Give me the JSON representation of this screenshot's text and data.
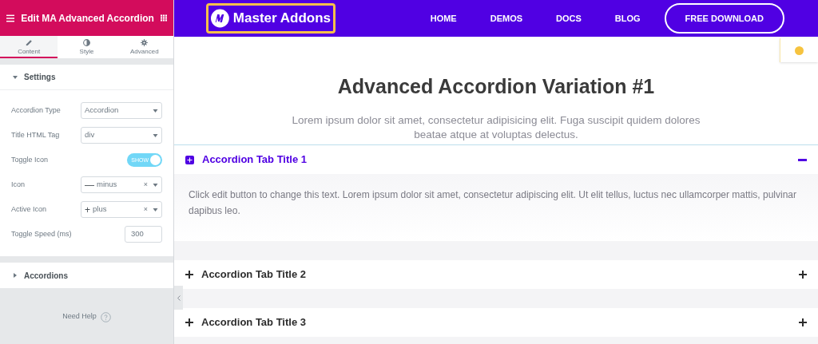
{
  "panel": {
    "title": "Edit MA Advanced Accordion",
    "tabs": [
      {
        "label": "Content",
        "selected": true
      },
      {
        "label": "Style",
        "selected": false
      },
      {
        "label": "Advanced",
        "selected": false
      }
    ],
    "sections": [
      {
        "title": "Settings",
        "expanded": true,
        "fields": [
          {
            "kind": "select",
            "label": "Accordion Type",
            "value": "Accordion"
          },
          {
            "kind": "select",
            "label": "Title HTML Tag",
            "value": "div"
          },
          {
            "kind": "toggle",
            "label": "Toggle Icon",
            "on": true,
            "text": "SHOW"
          },
          {
            "kind": "icon",
            "label": "Icon",
            "glyph": "—",
            "value": "minus",
            "clear": "×"
          },
          {
            "kind": "icon",
            "label": "Active Icon",
            "glyph": "+",
            "value": "plus",
            "clear": "×"
          },
          {
            "kind": "number",
            "label": "Toggle Speed (ms)",
            "value": "300"
          }
        ]
      },
      {
        "title": "Accordions",
        "expanded": false
      }
    ],
    "help": "Need Help"
  },
  "site": {
    "logo": "Master Addons",
    "nav": [
      "HOME",
      "DEMOS",
      "DOCS",
      "BLOG"
    ],
    "cta": "FREE DOWNLOAD",
    "heading": "Advanced Accordion Variation #1",
    "intro": "Lorem ipsum dolor sit amet, consectetur adipisicing elit. Fuga suscipit quidem dolores beatae atque at voluptas delectus.",
    "accordion": [
      {
        "title": "Accordion Tab Title 1",
        "expanded": true,
        "body": "Click edit button to change this text. Lorem ipsum dolor sit amet, consectetur adipiscing elit. Ut elit tellus, luctus nec ullamcorper mattis, pulvinar dapibus leo."
      },
      {
        "title": "Accordion Tab Title 2",
        "expanded": false
      },
      {
        "title": "Accordion Tab Title 3",
        "expanded": false
      }
    ]
  }
}
